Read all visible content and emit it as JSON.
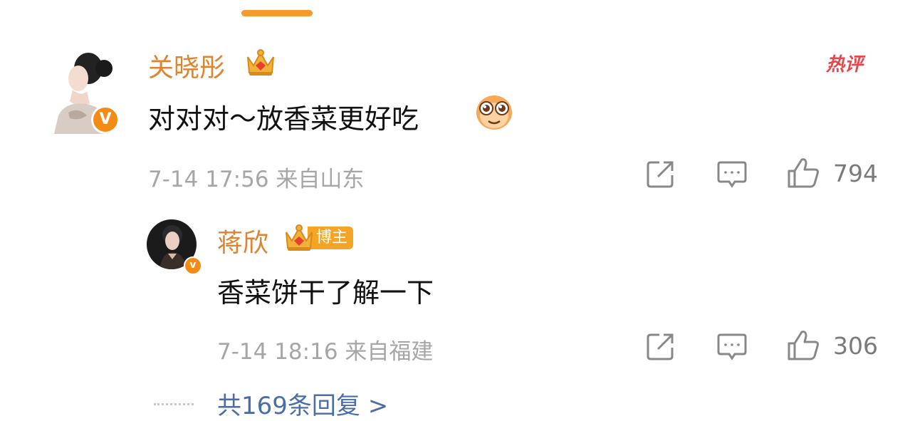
{
  "comments": [
    {
      "username": "关晓彤",
      "text": "对对对～放香菜更好吃",
      "time": "7-14 17:56",
      "location": "来自山东",
      "likes": "794",
      "tag": "热评",
      "verified_badge": "V",
      "emoji": "star-eyes-emoji"
    }
  ],
  "reply": {
    "username": "蒋欣",
    "badge": "博主",
    "text": "香菜饼干了解一下",
    "time": "7-14 18:16",
    "location": "来自福建",
    "likes": "306",
    "verified_badge": "v"
  },
  "more_replies": "共169条回复 >",
  "colors": {
    "accent": "#f59a2c",
    "username": "#e0832d",
    "hot": "#e5474c",
    "link": "#4a6ea5",
    "meta": "#a6a6a6"
  }
}
